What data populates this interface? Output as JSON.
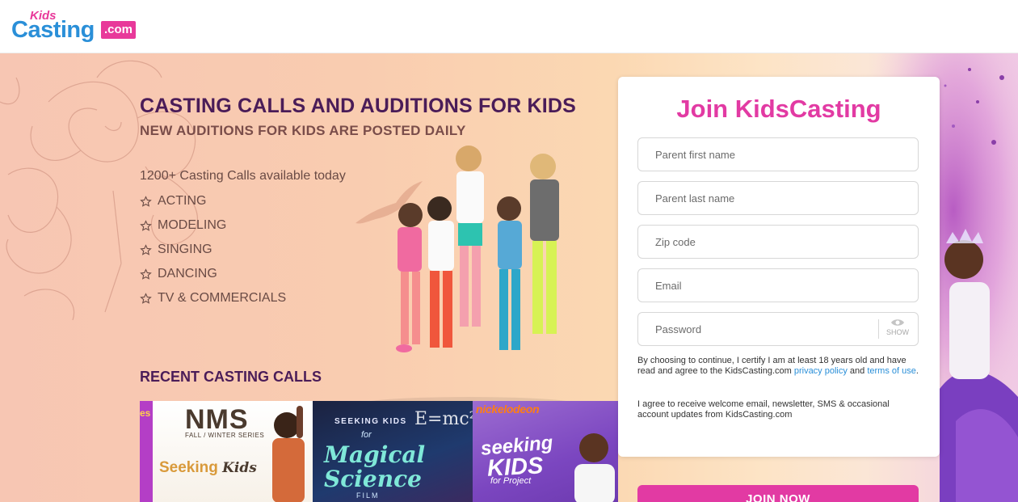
{
  "header": {
    "logo_kids": "Kids",
    "logo_casting": "Casting",
    "logo_dotcom": ".com"
  },
  "hero": {
    "headline": "CASTING CALLS AND AUDITIONS FOR KIDS",
    "subhead": "NEW AUDITIONS FOR KIDS ARE POSTED DAILY",
    "count": "1200+ Casting Calls available today",
    "features": [
      "ACTING",
      "MODELING",
      "SINGING",
      "DANCING",
      "TV & COMMERCIALS"
    ]
  },
  "recent": {
    "title": "RECENT CASTING CALLS",
    "cards": [
      {
        "text": "es"
      },
      {
        "title": "NMS",
        "subtitle": "FALL / WINTER SERIES",
        "line1": "Seeking",
        "line2": "Kids"
      },
      {
        "top": "SEEKING KIDS",
        "for": "for",
        "line1": "Magical",
        "line2": "Science",
        "footer": "FILM",
        "equation": "E=mc²"
      },
      {
        "brand": "nickelodeon",
        "line1": "seeking",
        "line2": "KIDS",
        "line3": "for Project"
      }
    ]
  },
  "form": {
    "title": "Join KidsCasting",
    "first_name_placeholder": "Parent first name",
    "last_name_placeholder": "Parent last name",
    "zip_placeholder": "Zip code",
    "email_placeholder": "Email",
    "password_placeholder": "Password",
    "show_label": "SHOW",
    "terms_prefix": "By choosing to continue, I certify I am at least 18 years old and have read and agree to the KidsCasting.com ",
    "privacy_link": "privacy policy",
    "terms_and": " and ",
    "terms_link": "terms of use",
    "terms_suffix": ".",
    "consent": "I agree to receive welcome email, newsletter, SMS & occasional account updates from KidsCasting.com",
    "join_button": "JOIN NOW"
  },
  "colors": {
    "brand_pink": "#e23aa3",
    "brand_blue": "#2a8fd8",
    "headline_purple": "#4a1c58"
  }
}
